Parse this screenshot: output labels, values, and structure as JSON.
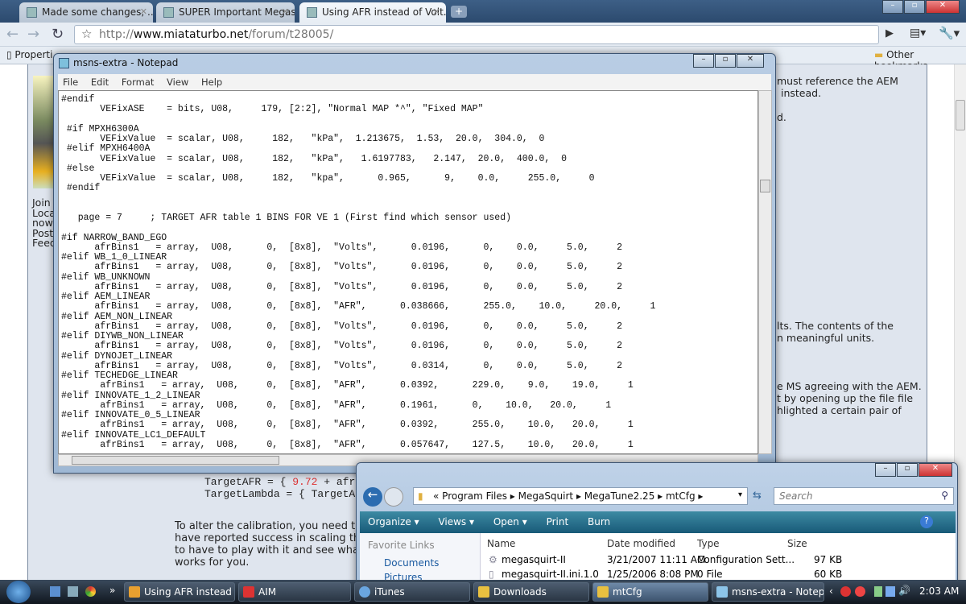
{
  "browser": {
    "tabs": [
      {
        "label": "Made some changes, ...",
        "icon": "download-icon"
      },
      {
        "label": "SUPER Important Megas..."
      },
      {
        "label": "Using AFR instead of Volt...",
        "active": true
      }
    ],
    "url_prefix": "http://",
    "url_domain": "www.miataturbo.net",
    "url_path": "/forum/t28005/",
    "bookmarks": {
      "first": "Properti",
      "other": "Other bookmarks"
    }
  },
  "page": {
    "left_fragments": [
      "Join",
      "Loca",
      "nowh",
      "Post",
      "Feed"
    ],
    "right_fragments": [
      "must reference the AEM",
      "instead.",
      "d.",
      "lts. The contents of the",
      "n meaningful units.",
      "e MS agreeing with the AEM.",
      "t by opening up the file file",
      "hlighted a certain pair of"
    ],
    "code_line1_pre": "TargetAFR = { ",
    "code_line1_num": "9.72",
    "code_line1_post": " + afrt",
    "code_line2": "TargetLambda = { TargetAF",
    "paragraph": [
      "To alter the calibration, you need to",
      "have reported success in scaling the",
      "to have to play with it and see wha",
      "works for you."
    ]
  },
  "notepad": {
    "title": "msns-extra - Notepad",
    "menu": [
      "File",
      "Edit",
      "Format",
      "View",
      "Help"
    ],
    "lines": [
      "#endif",
      "       VEFixASE    = bits, U08,     179, [2:2], \"Normal MAP *^\", \"Fixed MAP\"",
      "",
      " #if MPXH6300A",
      "       VEFixValue  = scalar, U08,     182,   \"kPa\",  1.213675,  1.53,  20.0,  304.0,  0",
      " #elif MPXH6400A",
      "       VEFixValue  = scalar, U08,     182,   \"kPa\",   1.6197783,   2.147,  20.0,  400.0,  0",
      " #else",
      "       VEFixValue  = scalar, U08,     182,   \"kpa\",      0.965,      9,    0.0,     255.0,     0",
      " #endif",
      "",
      "",
      "   page = 7     ; TARGET AFR table 1 BINS FOR VE 1 (First find which sensor used)",
      "",
      "#if NARROW_BAND_EGO",
      "      afrBins1   = array,  U08,      0,  [8x8],  \"Volts\",      0.0196,      0,    0.0,     5.0,     2",
      "#elif WB_1_0_LINEAR",
      "      afrBins1   = array,  U08,      0,  [8x8],  \"Volts\",      0.0196,      0,    0.0,     5.0,     2",
      "#elif WB_UNKNOWN",
      "      afrBins1   = array,  U08,      0,  [8x8],  \"Volts\",      0.0196,      0,    0.0,     5.0,     2",
      "#elif AEM_LINEAR",
      "      afrBins1   = array,  U08,      0,  [8x8],  \"AFR\",      0.038666,      255.0,    10.0,     20.0,     1",
      "#elif AEM_NON_LINEAR",
      "      afrBins1   = array,  U08,      0,  [8x8],  \"Volts\",      0.0196,      0,    0.0,     5.0,     2",
      "#elif DIYWB_NON_LINEAR",
      "      afrBins1   = array,  U08,      0,  [8x8],  \"Volts\",      0.0196,      0,    0.0,     5.0,     2",
      "#elif DYNOJET_LINEAR",
      "      afrBins1   = array,  U08,      0,  [8x8],  \"Volts\",      0.0314,      0,    0.0,     5.0,     2",
      "#elif TECHEDGE_LINEAR",
      "       afrBins1   = array,  U08,     0,  [8x8],  \"AFR\",      0.0392,      229.0,    9.0,    19.0,     1",
      "#elif INNOVATE_1_2_LINEAR",
      "       afrBins1   = array,  U08,     0,  [8x8],  \"AFR\",      0.1961,      0,    10.0,   20.0,     1",
      "#elif INNOVATE_0_5_LINEAR",
      "       afrBins1   = array,  U08,     0,  [8x8],  \"AFR\",      0.0392,      255.0,    10.0,   20.0,     1",
      "#elif INNOVATE_LC1_DEFAULT",
      "       afrBins1   = array,  U08,     0,  [8x8],  \"AFR\",      0.057647,    127.5,    10.0,   20.0,     1"
    ]
  },
  "explorer": {
    "breadcrumb": [
      "«",
      "Program Files",
      "MegaSquirt",
      "MegaTune2.25",
      "mtCfg"
    ],
    "search_placeholder": "Search",
    "commands": [
      "Organize ▾",
      "Views ▾",
      "Open ▾",
      "Print",
      "Burn"
    ],
    "favorite_links_label": "Favorite Links",
    "favorite_links": [
      "Documents",
      "Pictures"
    ],
    "columns": [
      "Name",
      "Date modified",
      "Type",
      "Size"
    ],
    "files": [
      {
        "name": "megasquirt-II",
        "date": "3/21/2007 11:11 AM",
        "type": "Configuration Sett...",
        "size": "97 KB"
      },
      {
        "name": "megasquirt-II.ini.1.0",
        "date": "1/25/2006 8:08 PM",
        "type": "0 File",
        "size": "60 KB"
      }
    ]
  },
  "taskbar": {
    "overflow": "»",
    "buttons": [
      {
        "label": "Using AFR instead ...",
        "color": "#e8a030"
      },
      {
        "label": "AIM",
        "color": "#d33"
      },
      {
        "label": "iTunes",
        "color": "#6aa6e0"
      },
      {
        "label": "Downloads",
        "color": "#e8c040"
      },
      {
        "label": "mtCfg",
        "color": "#e8c040",
        "active": true
      },
      {
        "label": "msns-extra - Notep...",
        "color": "#8cc4e8"
      }
    ],
    "clock": "2:03 AM"
  }
}
